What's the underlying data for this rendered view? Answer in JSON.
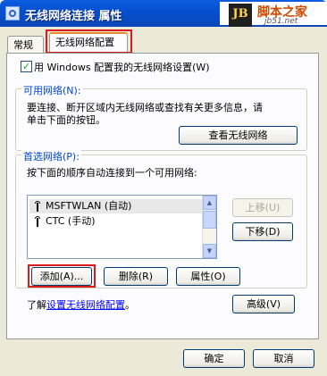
{
  "window": {
    "title": "无线网络连接 属性"
  },
  "watermark": {
    "badge": "JB",
    "name": "脚本之家",
    "url": "jb51.net"
  },
  "tabs": [
    {
      "label": "常规"
    },
    {
      "label": "无线网络配置"
    }
  ],
  "use_windows_config": {
    "checked": true,
    "label": "用 Windows 配置我的无线网络设置(W)"
  },
  "available_networks": {
    "legend": "可用网络(N):",
    "description_line1": "要连接、断开区域内无线网络或查找有关更多信息，请",
    "description_line2": "单击下面的按钮。",
    "view_button": "查看无线网络"
  },
  "preferred_networks": {
    "legend": "首选网络(P):",
    "description": "按下面的顺序自动连接到一个可用网络:",
    "items": [
      {
        "label": "MSFTWLAN (自动)",
        "icon": "antenna-icon"
      },
      {
        "label": "CTC (手动)",
        "icon": "antenna-icon"
      }
    ],
    "move_up": "上移(U)",
    "move_down": "下移(D)",
    "add": "添加(A)...",
    "remove": "删除(R)",
    "properties": "属性(O)"
  },
  "learn_more": {
    "prefix": "了解",
    "link": "设置无线网络配置",
    "suffix": "。"
  },
  "advanced_button": "高级(V)",
  "footer": {
    "ok": "确定",
    "cancel": "取消"
  },
  "colors": {
    "title_bar": "#0650d0",
    "dialog_bg": "#ece9d8",
    "highlight_box": "#d81b1b",
    "legend_text": "#0046d5"
  }
}
